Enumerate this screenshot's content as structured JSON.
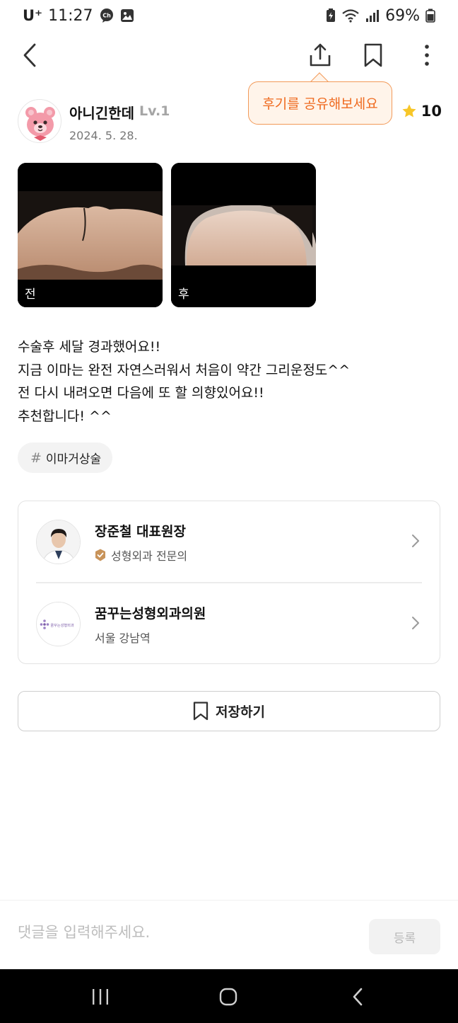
{
  "status_bar": {
    "carrier": "U⁺",
    "time": "11:27",
    "battery": "69%",
    "icons": [
      "chat-ch-icon",
      "gallery-icon",
      "battery-saver-icon",
      "wifi-icon",
      "signal-icon",
      "battery-icon"
    ]
  },
  "nav": {
    "icons": [
      "back-arrow-icon",
      "share-icon",
      "bookmark-icon",
      "more-vertical-icon"
    ]
  },
  "tooltip": {
    "text": "후기를 공유해보세요"
  },
  "author": {
    "name": "아니긴한데",
    "level": "Lv.1",
    "date": "2024. 5. 28.",
    "rating": "10",
    "avatar_icon": "pink-bear-avatar-icon"
  },
  "photos": [
    {
      "label": "전",
      "level": "before"
    },
    {
      "label": "후",
      "level": "after"
    }
  ],
  "review": {
    "lines": [
      "수술후 세달 경과했어요!!",
      "지금 이마는 완전 자연스러워서 처음이 약간 그리운정도^^",
      "전 다시 내려오면 다음에 또 할 의향있어요!!",
      "추천합니다! ^^"
    ]
  },
  "tag": {
    "hash": "#",
    "label": "이마거상술"
  },
  "doctor": {
    "name": "장준철 대표원장",
    "specialty": "성형외과 전문의"
  },
  "clinic": {
    "name": "꿈꾸는성형외과의원",
    "location": "서울 강남역",
    "logo_text": "꿈꾸는성형외과"
  },
  "save_button": {
    "label": "저장하기"
  },
  "comment": {
    "placeholder": "댓글을 입력해주세요.",
    "submit_label": "등록"
  },
  "colors": {
    "accent_orange": "#ef6a1f",
    "tooltip_bg": "#fff4ea",
    "star": "#f7c628",
    "verified_badge": "#c8935a"
  }
}
